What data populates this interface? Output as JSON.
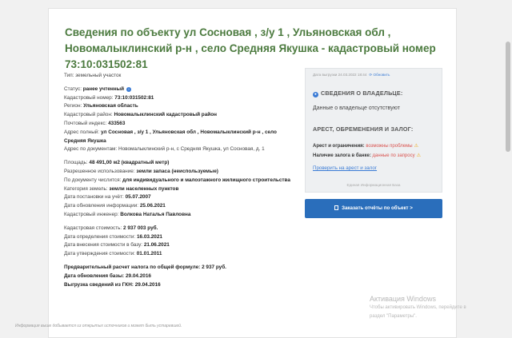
{
  "title": "Сведения по объекту ул Сосновая , з/у 1 , Ульяновская обл , Новомалыклинский р-н , село Средняя Якушка - кадастровый номер 73:10:031502:81",
  "props": {
    "type": "Тип: земельный участок",
    "status_label": "Статус:",
    "status_value": "ранее учтенный",
    "cad_label": "Кадастровый номер:",
    "cad_value": "73:10:031502:81",
    "region_label": "Регион:",
    "region_value": "Ульяновская область",
    "district_label": "Кадастровый район:",
    "district_value": "Новомалыклинский кадастровый район",
    "postal_label": "Почтовый индекс:",
    "postal_value": "433563",
    "addr_full_label": "Адрес полный:",
    "addr_full_value": "ул Сосновая , з/у 1 , Ульяновская обл , Новомалыклинский р-н , село Средняя Якушка",
    "addr_doc": "Адрес по документам: Новомалыклинский р-н, с Средняя Якушка, ул Сосновая, д. 1",
    "area_label": "Площадь:",
    "area_value": "48 491,00 м2 (квадратный метр)",
    "use_label": "Разрешенное использование:",
    "use_value": "земли запаса (неиспользуемые)",
    "doc_label": "По документу числится:",
    "doc_value": "для индивидуального и малоэтажного жилищного строительства",
    "cat_label": "Категория земель:",
    "cat_value": "земли населенных пунктов",
    "reg_date_label": "Дата постановки на учёт:",
    "reg_date_value": "05.07.2007",
    "info_date_label": "Дата обновления информации:",
    "info_date_value": "25.06.2021",
    "engineer_label": "Кадастровый инженер:",
    "engineer_value": "Волкова Наталья Павловна",
    "cost_label": "Кадастровая стоимость:",
    "cost_value": "2 937 003 руб.",
    "cost_det_label": "Дата определения стоимости:",
    "cost_det_value": "16.03.2021",
    "cost_ent_label": "Дата внесения стоимости в базу:",
    "cost_ent_value": "21.06.2021",
    "cost_app_label": "Дата утверждения стоимости:",
    "cost_app_value": "01.01.2011",
    "tax_label": "Предварительный расчет налога по общей формуле:",
    "tax_value": "2 937 руб.",
    "base_upd_label": "Дата обновления базы:",
    "base_upd_value": "29.04.2016",
    "egrn_label": "Выгрузка сведений из ГКН:",
    "egrn_value": "29.04.2016",
    "footnote": "Информация выше добывается из открытых источников и может быть устаревшей."
  },
  "panel": {
    "updated": "Дата выгрузки 24.03.2022 18:44",
    "refresh": "Обновить",
    "owner_heading": "СВЕДЕНИЯ О ВЛАДЕЛЬЦЕ:",
    "owner_text": "Данные о владельце отсутствуют",
    "arrest_heading": "АРЕСТ, ОБРЕМЕНЕНИЯ И ЗАЛОГ:",
    "arrest_label": "Арест и ограничения:",
    "arrest_value": "возможны проблемы",
    "pledge_label": "Наличие залога в банке:",
    "pledge_value": "данные по запросу",
    "check_link": "Проверить на арест и залог",
    "base_note": "Единая Информационная База"
  },
  "order_button": "Заказать отчёты по объект >",
  "watermark": {
    "line1": "Активация Windows",
    "line2": "Чтобы активировать Windows, перейдите в",
    "line3": "раздел \"Параметры\"."
  },
  "icons": {
    "info": "info-icon",
    "user": "user-icon",
    "refresh": "refresh-icon",
    "warning": "warning-icon",
    "document": "document-icon"
  },
  "colors": {
    "title": "#4b7a3e",
    "accent": "#3a7bd5",
    "button": "#2a6ebb",
    "danger": "#d9534f",
    "warning": "#f0a30a"
  }
}
